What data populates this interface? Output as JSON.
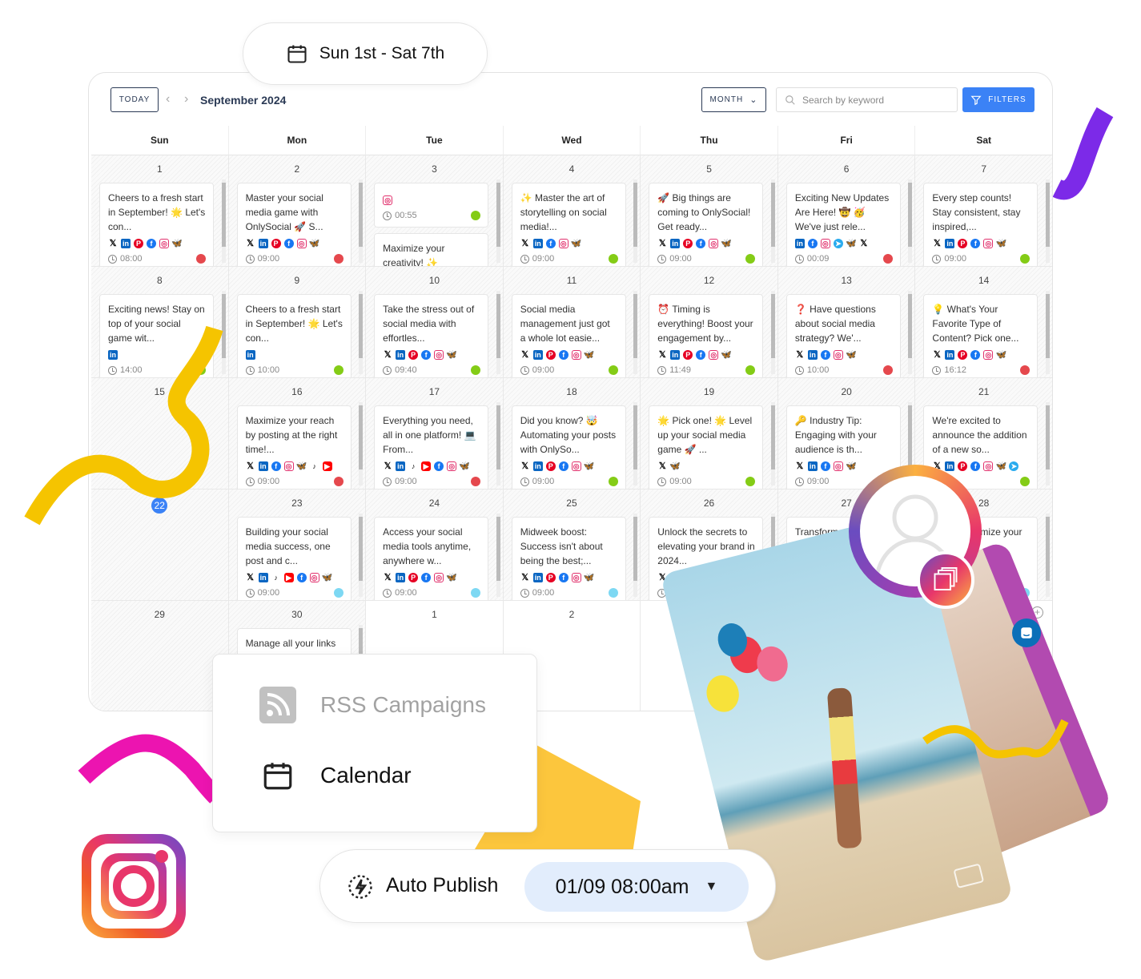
{
  "date_range_pill": {
    "label": "Sun 1st - Sat 7th",
    "icon": "calendar-icon"
  },
  "toolbar": {
    "today": "TODAY",
    "month_title": "September 2024",
    "view": "MONTH",
    "search_placeholder": "Search by keyword",
    "filters": "FILTERS"
  },
  "weekdays": [
    "Sun",
    "Mon",
    "Tue",
    "Wed",
    "Thu",
    "Fri",
    "Sat"
  ],
  "status_colors": {
    "red": "#e5484d",
    "green": "#84cc16",
    "cyan": "#7dd8f3"
  },
  "weeks": [
    [
      {
        "date": "1",
        "posts": [
          {
            "text": "Cheers to a fresh start in September! 🌟 Let's con...",
            "icons": [
              "x",
              "linkedin",
              "pinterest",
              "facebook",
              "instagram",
              "bluesky"
            ],
            "time": "08:00",
            "status": "red"
          }
        ]
      },
      {
        "date": "2",
        "posts": [
          {
            "text": "Master your social media game with OnlySocial 🚀 S...",
            "icons": [
              "x",
              "linkedin",
              "pinterest",
              "facebook",
              "instagram",
              "bluesky"
            ],
            "time": "09:00",
            "status": "red"
          }
        ]
      },
      {
        "date": "3",
        "posts": [
          {
            "text": "",
            "icons": [
              "instagram"
            ],
            "time": "00:55",
            "status": "green"
          },
          {
            "text": "Maximize your creativity! ✨",
            "icons": [],
            "time": "",
            "status": ""
          }
        ]
      },
      {
        "date": "4",
        "posts": [
          {
            "text": "✨ Master the art of storytelling on social media!...",
            "icons": [
              "x",
              "linkedin",
              "facebook",
              "instagram",
              "bluesky"
            ],
            "time": "09:00",
            "status": "green"
          }
        ]
      },
      {
        "date": "5",
        "posts": [
          {
            "text": "🚀 Big things are coming to OnlySocial! Get ready...",
            "icons": [
              "x",
              "linkedin",
              "pinterest",
              "facebook",
              "instagram",
              "bluesky"
            ],
            "time": "09:00",
            "status": "green"
          }
        ]
      },
      {
        "date": "6",
        "posts": [
          {
            "text": "Exciting New Updates Are Here! 🤠 🥳 We've just rele...",
            "icons": [
              "linkedin",
              "facebook",
              "instagram",
              "telegram",
              "bluesky",
              "x"
            ],
            "time": "00:09",
            "status": "red"
          }
        ]
      },
      {
        "date": "7",
        "posts": [
          {
            "text": "Every step counts! Stay consistent, stay inspired,...",
            "icons": [
              "x",
              "linkedin",
              "pinterest",
              "facebook",
              "instagram",
              "bluesky"
            ],
            "time": "09:00",
            "status": "green"
          }
        ]
      }
    ],
    [
      {
        "date": "8",
        "posts": [
          {
            "text": "Exciting news! Stay on top of your social game wit...",
            "icons": [
              "linkedin"
            ],
            "time": "14:00",
            "status": "green"
          }
        ]
      },
      {
        "date": "9",
        "posts": [
          {
            "text": "Cheers to a fresh start in September! 🌟 Let's con...",
            "icons": [
              "linkedin"
            ],
            "time": "10:00",
            "status": "green"
          }
        ]
      },
      {
        "date": "10",
        "posts": [
          {
            "text": "Take the stress out of social media with effortles...",
            "icons": [
              "x",
              "linkedin",
              "pinterest",
              "facebook",
              "instagram",
              "bluesky"
            ],
            "time": "09:40",
            "status": "green"
          }
        ]
      },
      {
        "date": "11",
        "posts": [
          {
            "text": "Social media management just got a whole lot easie...",
            "icons": [
              "x",
              "linkedin",
              "pinterest",
              "facebook",
              "instagram",
              "bluesky"
            ],
            "time": "09:00",
            "status": "green"
          }
        ]
      },
      {
        "date": "12",
        "posts": [
          {
            "text": "⏰ Timing is everything! Boost your engagement by...",
            "icons": [
              "x",
              "linkedin",
              "pinterest",
              "facebook",
              "instagram",
              "bluesky"
            ],
            "time": "11:49",
            "status": "green"
          }
        ]
      },
      {
        "date": "13",
        "posts": [
          {
            "text": "❓ Have questions about social media strategy? We'...",
            "icons": [
              "x",
              "linkedin",
              "facebook",
              "instagram",
              "bluesky"
            ],
            "time": "10:00",
            "status": "red"
          }
        ]
      },
      {
        "date": "14",
        "posts": [
          {
            "text": "💡 What's Your Favorite Type of Content? Pick one...",
            "icons": [
              "x",
              "linkedin",
              "pinterest",
              "facebook",
              "instagram",
              "bluesky"
            ],
            "time": "16:12",
            "status": "red"
          }
        ]
      }
    ],
    [
      {
        "date": "15",
        "posts": []
      },
      {
        "date": "16",
        "posts": [
          {
            "text": "Maximize your reach by posting at the right time!...",
            "icons": [
              "x",
              "linkedin",
              "facebook",
              "instagram",
              "bluesky",
              "tiktok",
              "youtube"
            ],
            "time": "09:00",
            "status": "red"
          }
        ]
      },
      {
        "date": "17",
        "posts": [
          {
            "text": "Everything you need, all in one platform! 💻 From...",
            "icons": [
              "x",
              "linkedin",
              "tiktok",
              "youtube",
              "facebook",
              "instagram",
              "bluesky"
            ],
            "time": "09:00",
            "status": "red"
          }
        ]
      },
      {
        "date": "18",
        "posts": [
          {
            "text": "Did you know? 🤯 Automating your posts with OnlySo...",
            "icons": [
              "x",
              "linkedin",
              "pinterest",
              "facebook",
              "instagram",
              "bluesky"
            ],
            "time": "09:00",
            "status": "green"
          }
        ]
      },
      {
        "date": "19",
        "posts": [
          {
            "text": "🌟 Pick one! 🌟 Level up your social media game 🚀 ...",
            "icons": [
              "x",
              "bluesky"
            ],
            "time": "09:00",
            "status": "green"
          }
        ]
      },
      {
        "date": "20",
        "posts": [
          {
            "text": "🔑 Industry Tip: Engaging with your audience is th...",
            "icons": [
              "x",
              "linkedin",
              "facebook",
              "instagram",
              "bluesky"
            ],
            "time": "09:00",
            "status": ""
          }
        ]
      },
      {
        "date": "21",
        "posts": [
          {
            "text": "We're excited to announce the addition of a new so...",
            "icons": [
              "x",
              "linkedin",
              "pinterest",
              "facebook",
              "instagram",
              "bluesky",
              "telegram"
            ],
            "time": "42",
            "status": "green"
          }
        ]
      }
    ],
    [
      {
        "date": "22",
        "today": true,
        "posts": []
      },
      {
        "date": "23",
        "posts": [
          {
            "text": "Building your social media success, one post and c...",
            "icons": [
              "x",
              "linkedin",
              "tiktok",
              "youtube",
              "facebook",
              "instagram",
              "bluesky"
            ],
            "time": "09:00",
            "status": "cyan"
          }
        ]
      },
      {
        "date": "24",
        "posts": [
          {
            "text": "Access your social media tools anytime, anywhere w...",
            "icons": [
              "x",
              "linkedin",
              "pinterest",
              "facebook",
              "instagram",
              "bluesky"
            ],
            "time": "09:00",
            "status": "cyan"
          }
        ]
      },
      {
        "date": "25",
        "posts": [
          {
            "text": "Midweek boost: Success isn't about being the best;...",
            "icons": [
              "x",
              "linkedin",
              "pinterest",
              "facebook",
              "instagram",
              "bluesky"
            ],
            "time": "09:00",
            "status": "cyan"
          }
        ]
      },
      {
        "date": "26",
        "posts": [
          {
            "text": "Unlock the secrets to elevating your brand in 2024...",
            "icons": [
              "x",
              "linkedin"
            ],
            "time": "09:00",
            "status": ""
          }
        ]
      },
      {
        "date": "27",
        "posts": [
          {
            "text": "Transform y...",
            "icons": [],
            "time": "",
            "status": ""
          }
        ]
      },
      {
        "date": "28",
        "posts": [
          {
            "text": "...ssions ...imize your ...d...",
            "icons": [
              "youtube",
              "facebook",
              "instagram",
              "bluesky"
            ],
            "time": "",
            "status": "cyan"
          }
        ]
      }
    ],
    [
      {
        "date": "29",
        "posts": []
      },
      {
        "date": "30",
        "posts": [
          {
            "text": "Manage all your links",
            "icons": [],
            "time": "",
            "status": ""
          }
        ]
      },
      {
        "date": "1",
        "plain": true,
        "posts": []
      },
      {
        "date": "2",
        "plain": true,
        "posts": []
      },
      {
        "date": "3",
        "plain": true,
        "posts": []
      },
      {
        "date": "4",
        "plain": true,
        "posts": []
      },
      {
        "date": "5",
        "plain": true,
        "posts": []
      }
    ]
  ],
  "menu_card": {
    "items": [
      {
        "label": "RSS Campaigns",
        "icon": "rss-icon",
        "muted": true
      },
      {
        "label": "Calendar",
        "icon": "calendar-icon",
        "muted": false
      }
    ]
  },
  "auto_publish": {
    "label": "Auto Publish",
    "icon": "auto-publish-icon",
    "datetime": "01/09 08:00am"
  },
  "accent": "#3b82f6"
}
